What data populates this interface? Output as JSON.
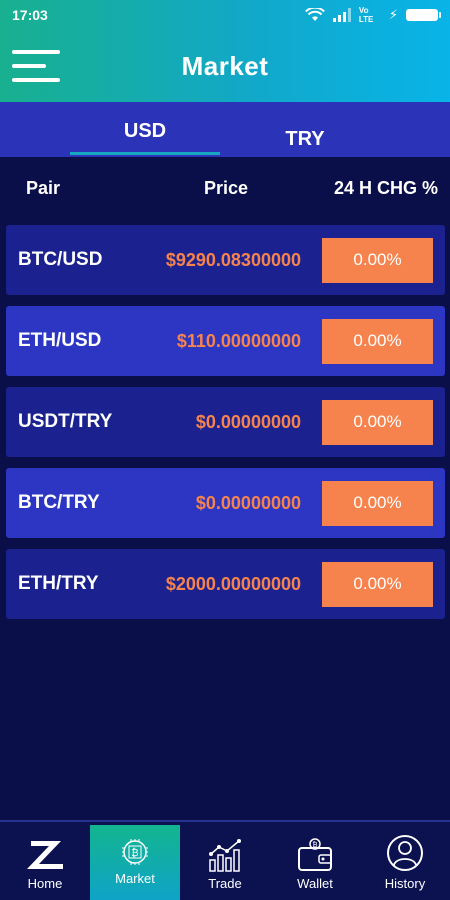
{
  "status_bar": {
    "time": "17:03",
    "network": "Vo LTE"
  },
  "app_bar": {
    "title": "Market"
  },
  "tabs": [
    {
      "label": "USD"
    },
    {
      "label": "TRY"
    }
  ],
  "columns": {
    "pair": "Pair",
    "price": "Price",
    "change": "24 H CHG %"
  },
  "rows": [
    {
      "pair": "BTC/USD",
      "price": "$9290.08300000",
      "change": "0.00%"
    },
    {
      "pair": "ETH/USD",
      "price": "$110.00000000",
      "change": "0.00%"
    },
    {
      "pair": "USDT/TRY",
      "price": "$0.00000000",
      "change": "0.00%"
    },
    {
      "pair": "BTC/TRY",
      "price": "$0.00000000",
      "change": "0.00%"
    },
    {
      "pair": "ETH/TRY",
      "price": "$2000.00000000",
      "change": "0.00%"
    }
  ],
  "bottom_nav": [
    {
      "label": "Home",
      "icon": "logo-z-icon"
    },
    {
      "label": "Market",
      "icon": "bitcoin-chip-icon"
    },
    {
      "label": "Trade",
      "icon": "chart-up-icon"
    },
    {
      "label": "Wallet",
      "icon": "wallet-icon"
    },
    {
      "label": "History",
      "icon": "user-circle-icon"
    }
  ],
  "colors": {
    "header_start": "#18b08f",
    "header_end": "#08b4e8",
    "background": "#0a0f4a",
    "row_dark": "#1b228f",
    "row_light": "#2d36c2",
    "accent_orange": "#f6834e"
  }
}
